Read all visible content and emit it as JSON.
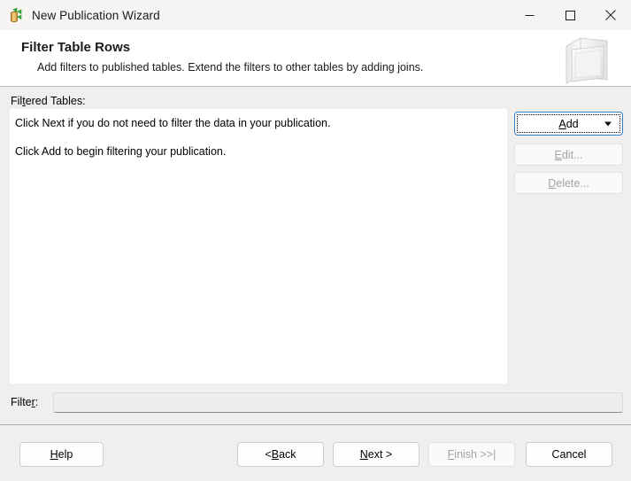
{
  "window": {
    "title": "New Publication Wizard",
    "icon": "publication-database-icon",
    "controls": {
      "minimize": "minimize-icon",
      "maximize": "maximize-icon",
      "close": "close-icon"
    }
  },
  "header": {
    "title": "Filter Table Rows",
    "subtitle": "Add filters to published tables. Extend the filters to other tables by adding joins.",
    "icon": "publication-box-icon"
  },
  "body": {
    "filtered_tables_label": "Filtered Tables:",
    "filtered_tables_label_parts": {
      "pre": "Fil",
      "acc": "t",
      "post": "ered Tables:"
    },
    "list_lines": [
      "Click Next if you do not need to filter the data in your publication.",
      "Click Add to begin filtering your publication."
    ],
    "buttons": {
      "add": {
        "label": "Add",
        "pre": "",
        "acc": "A",
        "post": "dd",
        "enabled": true,
        "focused": true,
        "has_dropdown": true
      },
      "edit": {
        "label": "Edit...",
        "pre": "",
        "acc": "E",
        "post": "dit...",
        "enabled": false
      },
      "delete": {
        "label": "Delete...",
        "pre": "",
        "acc": "D",
        "post": "elete...",
        "enabled": false
      }
    }
  },
  "filter": {
    "label": "Filter:",
    "label_parts": {
      "pre": "Filte",
      "acc": "r",
      "post": ":"
    },
    "value": "",
    "placeholder": ""
  },
  "footer": {
    "help": {
      "label": "Help",
      "pre": "",
      "acc": "H",
      "post": "elp",
      "enabled": true
    },
    "back": {
      "label": "< Back",
      "pre": "< ",
      "acc": "B",
      "post": "ack",
      "enabled": true
    },
    "next": {
      "label": "Next >",
      "pre": "",
      "acc": "N",
      "post": "ext >",
      "enabled": true
    },
    "finish": {
      "label": "Finish >>|",
      "pre": "",
      "acc": "F",
      "post": "inish >>|",
      "enabled": false
    },
    "cancel": {
      "label": "Cancel",
      "pre": "",
      "acc": "",
      "post": "Cancel",
      "enabled": false
    }
  },
  "colors": {
    "accent": "#2f7fd1",
    "titlebar_bg": "#f6f4f2",
    "header_bg": "#ffffff",
    "body_bg": "#f0efee",
    "list_bg": "#ffffff",
    "disabled_text": "#a2a2a2"
  }
}
